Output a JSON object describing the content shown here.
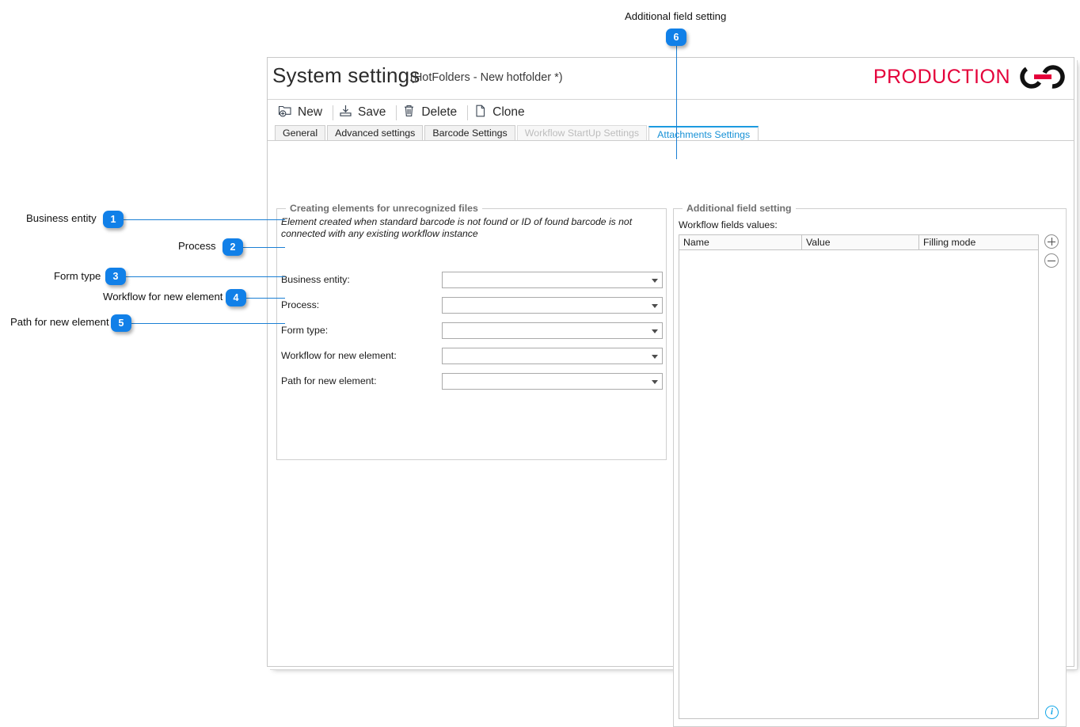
{
  "window": {
    "title": "System settings",
    "subtitle": "(HotFolders - New hotfolder *)",
    "brand_text": "PRODUCTION",
    "brand_accent": "#e4003a",
    "logo_icon": "linked-rings-logo"
  },
  "toolbar": {
    "buttons": [
      {
        "label": "New",
        "icon": "new-folder-icon"
      },
      {
        "label": "Save",
        "icon": "save-icon"
      },
      {
        "label": "Delete",
        "icon": "trash-icon"
      },
      {
        "label": "Clone",
        "icon": "copy-page-icon"
      }
    ]
  },
  "tabs": [
    {
      "label": "General",
      "state": "normal"
    },
    {
      "label": "Advanced settings",
      "state": "normal"
    },
    {
      "label": "Barcode Settings",
      "state": "normal"
    },
    {
      "label": "Workflow StartUp Settings",
      "state": "disabled"
    },
    {
      "label": "Attachments Settings",
      "state": "active"
    }
  ],
  "left_panel": {
    "title": "Creating elements for unrecognized files",
    "description": "Element created when standard barcode is not found or ID of found barcode  is not connected with any existing workflow instance",
    "fields": [
      {
        "label": "Business entity:",
        "value": "",
        "control": "dropdown"
      },
      {
        "label": "Process:",
        "value": "",
        "control": "dropdown"
      },
      {
        "label": "Form type:",
        "value": "",
        "control": "dropdown"
      },
      {
        "label": "Workflow for new element:",
        "value": "",
        "control": "dropdown"
      },
      {
        "label": "Path for new element:",
        "value": "",
        "control": "dropdown"
      }
    ]
  },
  "right_panel": {
    "title": "Additional field setting",
    "grid_label": "Workflow fields values:",
    "columns": [
      "Name",
      "Value",
      "Filling mode"
    ],
    "rows": [],
    "add_button": "add-row-button",
    "remove_button": "remove-row-button",
    "info_button": "info-icon"
  },
  "callouts": [
    {
      "number": "1",
      "label": "Business entity"
    },
    {
      "number": "2",
      "label": "Process"
    },
    {
      "number": "3",
      "label": "Form type"
    },
    {
      "number": "4",
      "label": "Workflow for new element"
    },
    {
      "number": "5",
      "label": "Path for new element"
    },
    {
      "number": "6",
      "label": "Additional field setting"
    }
  ],
  "accent_color": "#1180e8"
}
